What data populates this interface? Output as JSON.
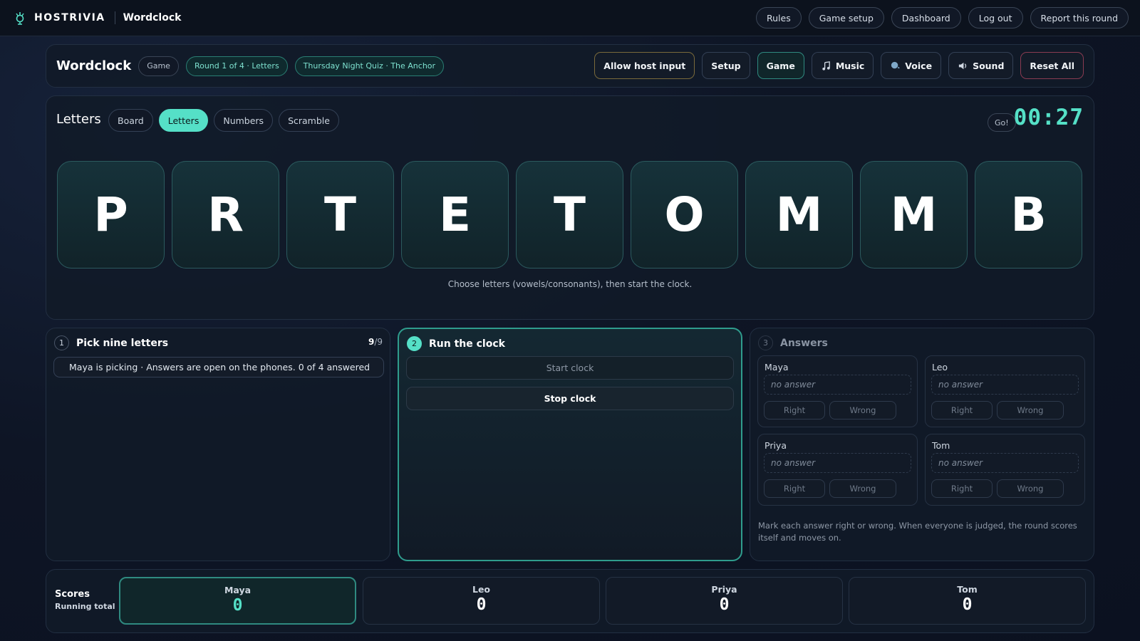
{
  "topbar": {
    "brand": "HOSTRIVIA",
    "app": "Wordclock",
    "nav": [
      "Rules",
      "Game setup",
      "Dashboard",
      "Log out",
      "Report this round"
    ]
  },
  "header": {
    "title": "Wordclock",
    "chip_game": "Game",
    "chip_round": "Round 1 of 4 · Letters",
    "chip_event": "Thursday Night Quiz · The Anchor",
    "actions": {
      "allow_host_input": "Allow host input",
      "setup": "Setup",
      "game": "Game",
      "music": "Music",
      "voice": "Voice",
      "sound": "Sound",
      "reset": "Reset All"
    }
  },
  "game": {
    "title": "Letters",
    "tabs": [
      "Board",
      "Letters",
      "Numbers",
      "Scramble"
    ],
    "active_tab": "Letters",
    "go_label": "Go!",
    "timer": "00:27",
    "letters": [
      "P",
      "R",
      "T",
      "E",
      "T",
      "O",
      "M",
      "M",
      "B"
    ],
    "hint": "Choose letters (vowels/consonants), then start the clock."
  },
  "step1": {
    "number": "1",
    "title": "Pick nine letters",
    "count_picked": "9",
    "count_total": "/9",
    "status": "Maya is picking · Answers are open on the phones. 0 of 4 answered"
  },
  "step2": {
    "number": "2",
    "title": "Run the clock",
    "start": "Start clock",
    "stop": "Stop clock"
  },
  "step3": {
    "number": "3",
    "title": "Answers",
    "players": [
      {
        "name": "Maya",
        "answer": "no answer",
        "right": "Right",
        "wrong": "Wrong"
      },
      {
        "name": "Leo",
        "answer": "no answer",
        "right": "Right",
        "wrong": "Wrong"
      },
      {
        "name": "Priya",
        "answer": "no answer",
        "right": "Right",
        "wrong": "Wrong"
      },
      {
        "name": "Tom",
        "answer": "no answer",
        "right": "Right",
        "wrong": "Wrong"
      }
    ],
    "note": "Mark each answer right or wrong. When everyone is judged, the round scores itself and moves on."
  },
  "scores": {
    "label": "Scores",
    "sublabel": "Running total",
    "players": [
      {
        "name": "Maya",
        "score": "0"
      },
      {
        "name": "Leo",
        "score": "0"
      },
      {
        "name": "Priya",
        "score": "0"
      },
      {
        "name": "Tom",
        "score": "0"
      }
    ]
  },
  "colors": {
    "accent": "#55e0c7",
    "background": "#0e1525",
    "tile": "#16323a"
  },
  "icons": [
    "brand-logo-icon",
    "music-note-icon",
    "voice-icon",
    "speaker-icon"
  ]
}
